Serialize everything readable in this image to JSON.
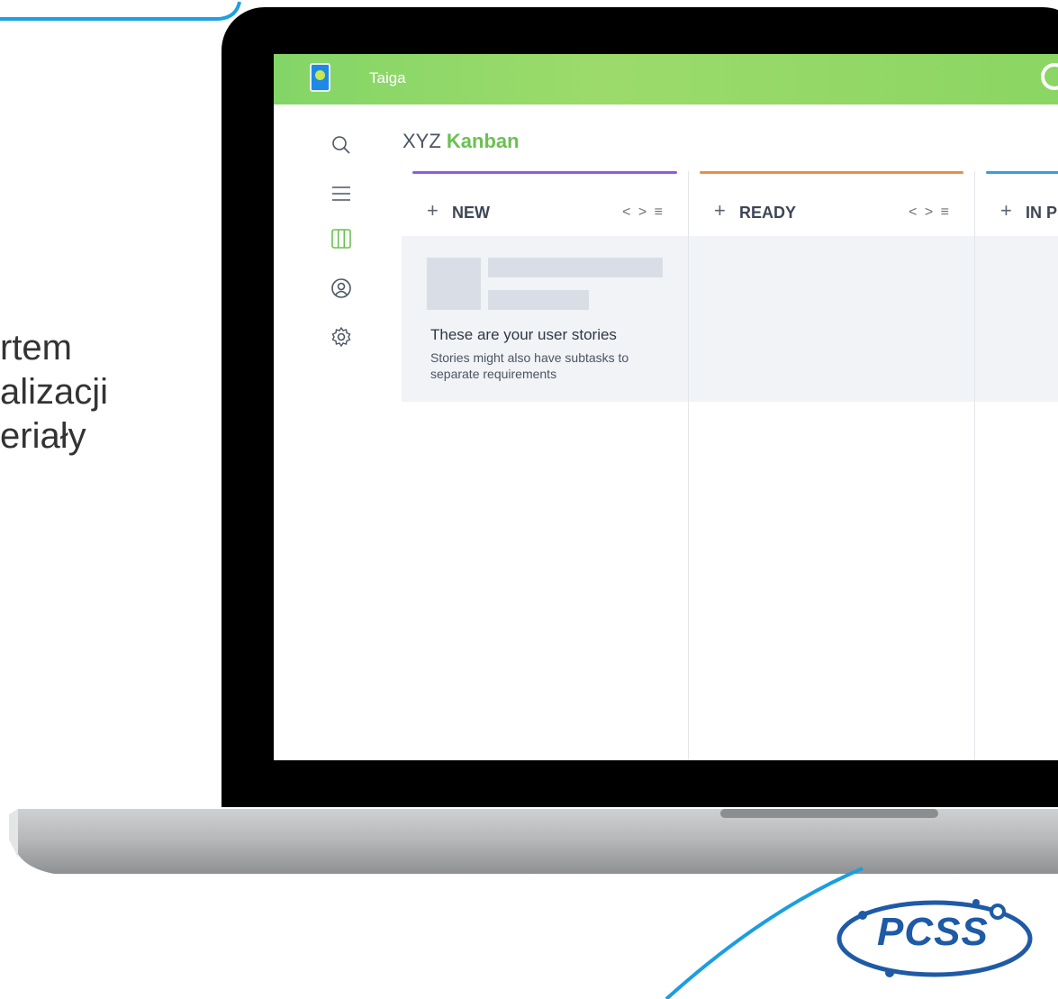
{
  "side_text": [
    "rtem",
    "alizacji",
    "eriały"
  ],
  "app": {
    "title": "Taiga",
    "logo_icon": "taiga-logo-icon",
    "help_icon": "help-icon"
  },
  "sidebar": {
    "items": [
      {
        "icon": "search-icon"
      },
      {
        "icon": "menu-icon"
      },
      {
        "icon": "kanban-icon",
        "active": true
      },
      {
        "icon": "user-icon"
      },
      {
        "icon": "settings-icon"
      }
    ]
  },
  "project": {
    "name": "XYZ",
    "view": "Kanban"
  },
  "columns": [
    {
      "plus": "+",
      "name": "NEW",
      "tools": "< > ≡",
      "color": "#8d5ae6"
    },
    {
      "plus": "+",
      "name": "READY",
      "tools": "< > ≡",
      "color": "#f08a4b"
    },
    {
      "plus": "+",
      "name": "IN PROGRESS",
      "tools": "< > ≡",
      "color": "#3b9ae1"
    }
  ],
  "empty_state": {
    "title": "These are your user stories",
    "subtitle": "Stories might also have subtasks to separate requirements"
  },
  "brand": {
    "logo_text": "PCSS",
    "accent": "#1a9ee0",
    "green": "#6ac14f"
  }
}
